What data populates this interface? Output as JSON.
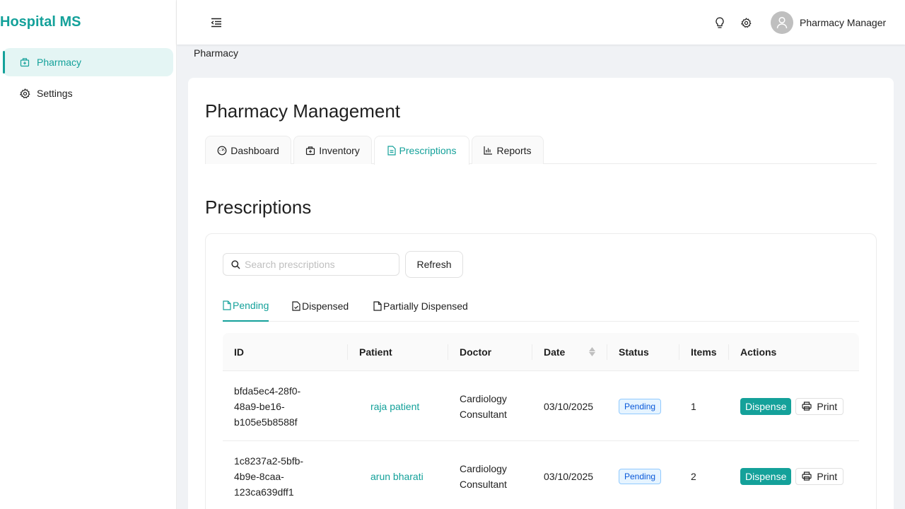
{
  "app": {
    "title": "Hospital MS"
  },
  "sidebar": {
    "items": [
      {
        "label": "Pharmacy",
        "icon": "medicine-box-icon",
        "active": true
      },
      {
        "label": "Settings",
        "icon": "gear-icon",
        "active": false
      }
    ]
  },
  "header": {
    "user_name": "Pharmacy Manager"
  },
  "breadcrumb": "Pharmacy",
  "page": {
    "title": "Pharmacy Management",
    "tabs": [
      {
        "label": "Dashboard",
        "icon": "dashboard-icon"
      },
      {
        "label": "Inventory",
        "icon": "medicine-box-icon"
      },
      {
        "label": "Prescriptions",
        "icon": "file-text-icon",
        "active": true
      },
      {
        "label": "Reports",
        "icon": "bar-chart-icon"
      }
    ]
  },
  "prescriptions": {
    "title": "Prescriptions",
    "search_placeholder": "Search prescriptions",
    "refresh_label": "Refresh",
    "subtabs": [
      {
        "label": "Pending",
        "active": true
      },
      {
        "label": "Dispensed"
      },
      {
        "label": "Partially Dispensed"
      }
    ],
    "columns": [
      "ID",
      "Patient",
      "Doctor",
      "Date",
      "Status",
      "Items",
      "Actions"
    ],
    "rows": [
      {
        "id_lines": [
          "bfda5ec4-28f0-",
          "48a9-be16-",
          "b105e5b8588f"
        ],
        "patient": "raja patient",
        "doctor_lines": [
          "Cardiology",
          "Consultant"
        ],
        "date": "03/10/2025",
        "status": "Pending",
        "items": "1",
        "dispense_label": "Dispense",
        "print_label": "Print"
      },
      {
        "id_lines": [
          "1c8237a2-5bfb-",
          "4b9e-8caa-",
          "123ca639dff1"
        ],
        "patient": "arun bharati",
        "doctor_lines": [
          "Cardiology",
          "Consultant"
        ],
        "date": "03/10/2025",
        "status": "Pending",
        "items": "2",
        "dispense_label": "Dispense",
        "print_label": "Print"
      }
    ]
  },
  "colors": {
    "accent": "#14a19a",
    "badge_blue": "#0958d9"
  }
}
